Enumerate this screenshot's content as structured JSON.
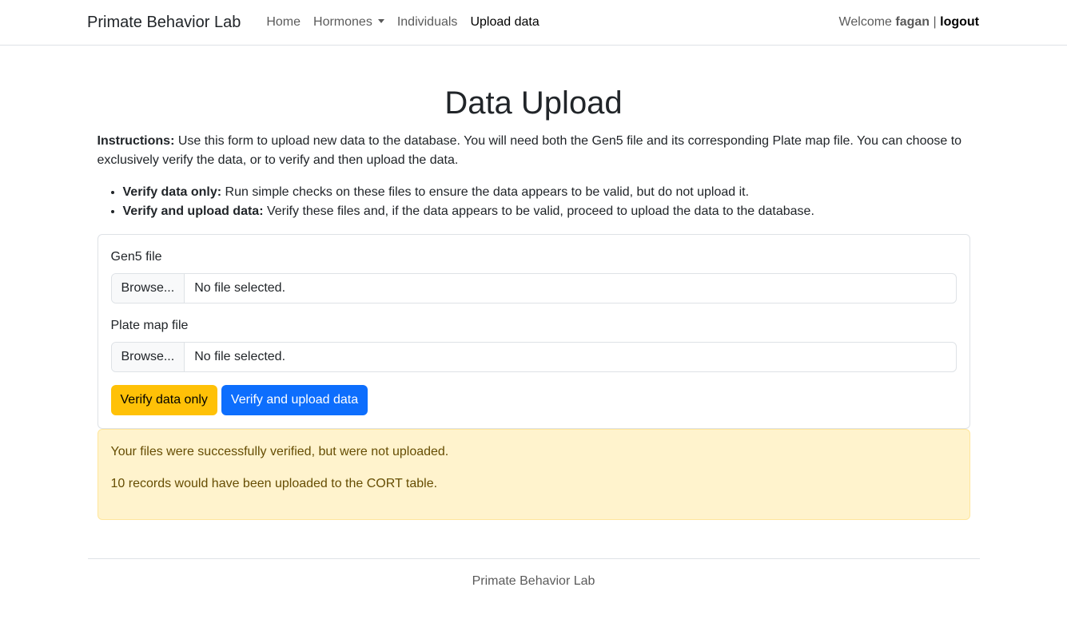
{
  "navbar": {
    "brand": "Primate Behavior Lab",
    "links": [
      {
        "label": "Home"
      },
      {
        "label": "Hormones"
      },
      {
        "label": "Individuals"
      },
      {
        "label": "Upload data"
      }
    ],
    "welcome": "Welcome",
    "username": "fagan",
    "separator": "|",
    "logout": "logout"
  },
  "page": {
    "title": "Data Upload",
    "instructions_label": "Instructions:",
    "instructions_text": " Use this form to upload new data to the database. You will need both the Gen5 file and its corresponding Plate map file. You can choose to exclusively verify the data, or to verify and then upload the data.",
    "options": [
      {
        "label": "Verify data only:",
        "text": " Run simple checks on these files to ensure the data appears to be valid, but do not upload it."
      },
      {
        "label": "Verify and upload data:",
        "text": " Verify these files and, if the data appears to be valid, proceed to upload the data to the database."
      }
    ]
  },
  "form": {
    "gen5_label": "Gen5 file",
    "plate_label": "Plate map file",
    "browse_label": "Browse...",
    "no_file_text": "No file selected.",
    "verify_button": "Verify data only",
    "upload_button": "Verify and upload data"
  },
  "alert": {
    "line1": "Your files were successfully verified, but were not uploaded.",
    "line2": "10 records would have been uploaded to the CORT table."
  },
  "footer": {
    "text": "Primate Behavior Lab"
  },
  "colors": {
    "warning": "#ffc107",
    "primary": "#0d6efd",
    "alert_bg": "#fff3cd",
    "alert_text": "#664d03"
  }
}
